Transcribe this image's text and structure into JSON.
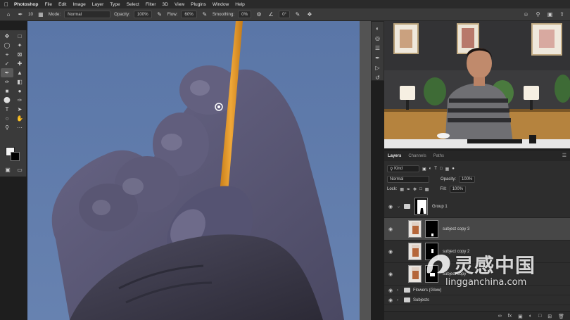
{
  "menubar": {
    "app_name": "Photoshop",
    "items": [
      "File",
      "Edit",
      "Image",
      "Layer",
      "Type",
      "Select",
      "Filter",
      "3D",
      "View",
      "Plugins",
      "Window",
      "Help"
    ]
  },
  "options_bar": {
    "brush_size": "10",
    "mode_label": "Mode:",
    "mode_value": "Normal",
    "opacity_label": "Opacity:",
    "opacity_value": "100%",
    "flow_label": "Flow:",
    "flow_value": "60%",
    "smoothing_label": "Smoothing:",
    "smoothing_value": "0%",
    "angle_value": "0°"
  },
  "layers_panel": {
    "tabs": [
      "Layers",
      "Channels",
      "Paths"
    ],
    "filter_kind": "Kind",
    "blend_mode": "Normal",
    "opacity_label": "Opacity:",
    "opacity_value": "100%",
    "lock_label": "Lock:",
    "fill_label": "Fill:",
    "fill_value": "100%",
    "layers": [
      {
        "name": "Group 1",
        "type": "group"
      },
      {
        "name": "subject copy 3",
        "type": "layer",
        "selected": true
      },
      {
        "name": "subject copy 2",
        "type": "layer"
      },
      {
        "name": "subject copy",
        "type": "layer"
      },
      {
        "name": "Flowers (Glow)",
        "type": "group"
      },
      {
        "name": "Subjects",
        "type": "group"
      }
    ]
  },
  "watermark": {
    "chinese": "灵感中国",
    "url": "lingganchina.com"
  },
  "colors": {
    "canvas_bg": "#5e78a8",
    "pencil": "#e39a2a",
    "hand": "#5c5a78",
    "panel": "#2d2d2d",
    "selected_layer": "#474747"
  }
}
